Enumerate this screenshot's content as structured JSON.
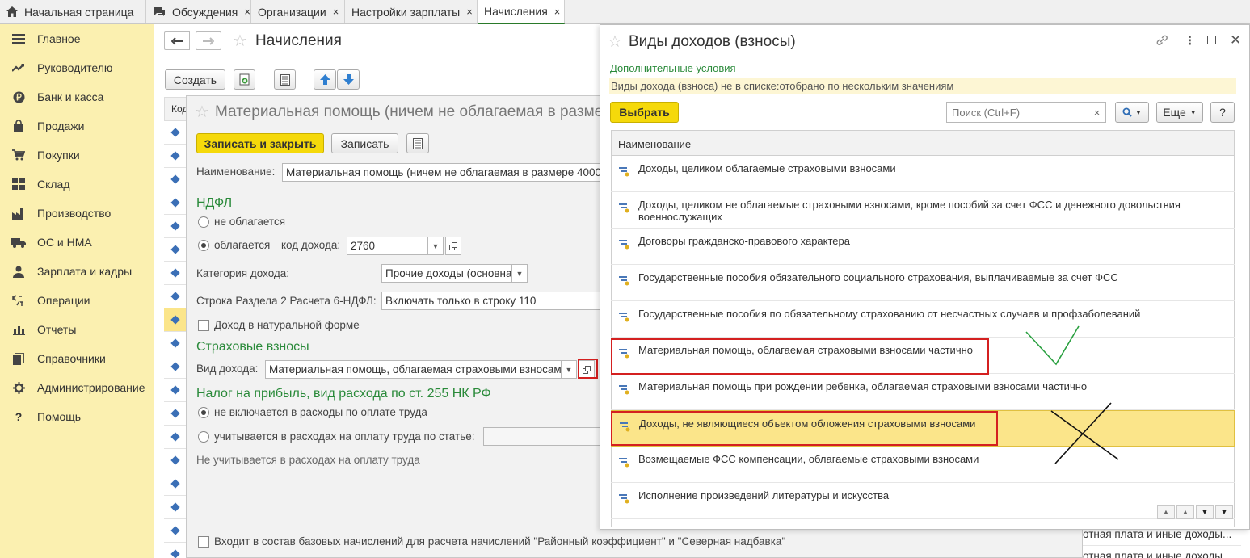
{
  "tabs": [
    {
      "label": "Начальная страница",
      "closable": false,
      "icon": "home-icon"
    },
    {
      "label": "Обсуждения",
      "closable": true,
      "icon": "chat-icon"
    },
    {
      "label": "Организации",
      "closable": true
    },
    {
      "label": "Настройки зарплаты",
      "closable": true
    },
    {
      "label": "Начисления",
      "closable": true,
      "active": true
    }
  ],
  "tab_close_glyph": "×",
  "sidebar": {
    "items": [
      {
        "label": "Главное",
        "icon": "menu-icon"
      },
      {
        "label": "Руководителю",
        "icon": "trend-icon"
      },
      {
        "label": "Банк и касса",
        "icon": "ruble-icon"
      },
      {
        "label": "Продажи",
        "icon": "bag-icon"
      },
      {
        "label": "Покупки",
        "icon": "cart-icon"
      },
      {
        "label": "Склад",
        "icon": "warehouse-icon"
      },
      {
        "label": "Производство",
        "icon": "factory-icon"
      },
      {
        "label": "ОС и НМА",
        "icon": "truck-icon"
      },
      {
        "label": "Зарплата и кадры",
        "icon": "person-icon"
      },
      {
        "label": "Операции",
        "icon": "operations-icon"
      },
      {
        "label": "Отчеты",
        "icon": "bar-chart-icon"
      },
      {
        "label": "Справочники",
        "icon": "books-icon"
      },
      {
        "label": "Администрирование",
        "icon": "gear-icon"
      },
      {
        "label": "Помощь",
        "icon": "help-icon"
      }
    ]
  },
  "main": {
    "title": "Начисления",
    "create_label": "Создать",
    "list_header": "Код",
    "bottom_cells": [
      "отная плата и иные доходы...",
      "отная плата и иные доходы..."
    ]
  },
  "inner": {
    "title": "Материальная помощь (ничем не облагаемая в размере",
    "save_close_label": "Записать и закрыть",
    "save_label": "Записать",
    "name_label": "Наименование:",
    "name_value": "Материальная помощь (ничем не облагаемая в размере 4000",
    "ndfl_section": "НДФЛ",
    "not_taxed_label": "не облагается",
    "taxed_label": "облагается",
    "income_code_label": "код дохода:",
    "income_code_value": "2760",
    "income_category_label": "Категория дохода:",
    "income_category_value": "Прочие доходы (основна",
    "section2_label": "Строка Раздела 2 Расчета 6-НДФЛ:",
    "section2_value": "Включать только в строку 110",
    "natural_form_label": "Доход в натуральной форме",
    "insurance_section": "Страховые взносы",
    "income_type_label": "Вид дохода:",
    "income_type_value": "Материальная помощь, облагаемая страховыми взносами",
    "profit_tax_section": "Налог на прибыль, вид расхода по ст. 255 НК РФ",
    "not_included_label": "не включается в расходы по оплате труда",
    "counted_label": "учитывается в расходах на оплату труда по статье:",
    "not_counted_note": "Не учитывается в расходах на оплату труда",
    "base_accruals_label": "Входит в состав базовых начислений для расчета начислений \"Районный коэффициент\" и \"Северная надбавка\""
  },
  "popup": {
    "title": "Виды доходов (взносы)",
    "extra_conditions_link": "Дополнительные условия",
    "filter_text": "Виды дохода (взноса) не в списке:отобрано по нескольким значениям",
    "select_label": "Выбрать",
    "search_placeholder": "Поиск (Ctrl+F)",
    "more_label": "Еще",
    "help_label": "?",
    "column_header": "Наименование",
    "rows": [
      "Доходы, целиком облагаемые страховыми взносами",
      "Доходы, целиком не облагаемые страховыми взносами, кроме пособий за счет ФСС и денежного довольствия военнослужащих",
      "Договоры гражданско-правового характера",
      "Государственные пособия обязательного социального страхования, выплачиваемые за счет ФСС",
      "Государственные пособия по обязательному страхованию от несчастных случаев и профзаболеваний",
      "Материальная помощь, облагаемая страховыми взносами частично",
      "Материальная помощь при рождении ребенка, облагаемая страховыми взносами частично",
      "Доходы, не являющиеся объектом обложения страховыми взносами",
      "Возмещаемые ФСС компенсации, облагаемые страховыми взносами",
      "Исполнение произведений литературы и искусства"
    ],
    "selected_row_index": 7
  },
  "colors": {
    "sidebar_bg": "#fbf0b0",
    "accent_green": "#2a8a3a",
    "highlight_yellow": "#fbe58a",
    "annotation_red": "#d42020",
    "button_yellow": "#f5d90b"
  }
}
